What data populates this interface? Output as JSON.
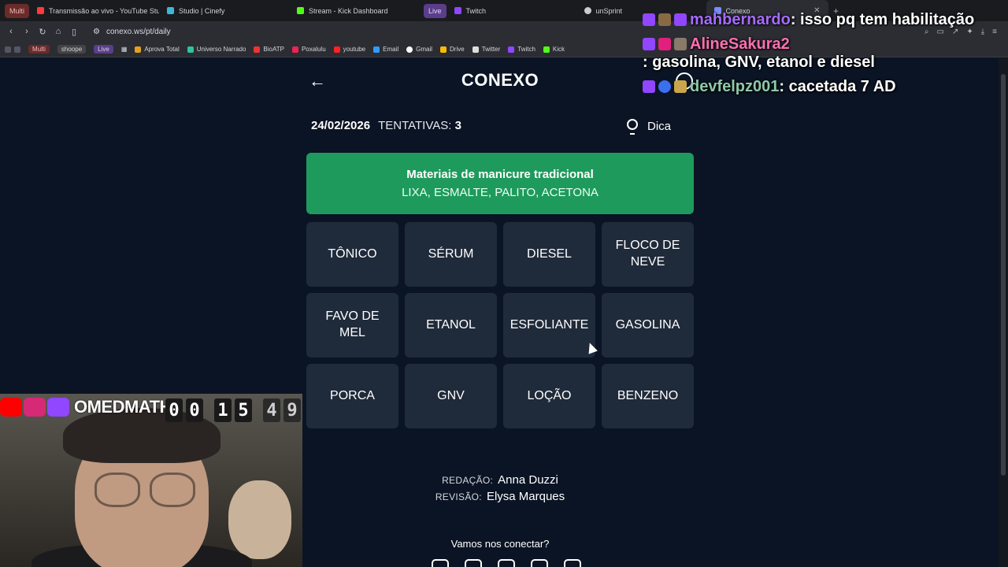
{
  "browser": {
    "tabs": [
      {
        "label": "Transmissão ao vivo - YouTube Studio",
        "color": "#ff3b3b"
      },
      {
        "label": "Studio | Cinefy",
        "color": "#3fb6d9"
      },
      {
        "label": "Stream - Kick Dashboard",
        "color": "#53fc18"
      },
      {
        "label": "Twitch",
        "color": "#9146ff"
      },
      {
        "label": "unSprint",
        "color": "#cccccc"
      },
      {
        "label": "Conexo",
        "color": "#7a8cff"
      }
    ],
    "multi_label": "Multi",
    "live_label": "Live",
    "url": "conexo.ws/pt/daily",
    "bookmarks": {
      "multi": "Multi",
      "shoope": "shoope",
      "live": "Live",
      "items": [
        "Aprova Total",
        "Universo Narrado",
        "BioATP",
        "Poxalulu",
        "youtube",
        "Email",
        "Gmail",
        "Drive",
        "Twitter",
        "Twitch",
        "Kick"
      ]
    }
  },
  "game": {
    "title": "CONEXO",
    "date": "24/02/2026",
    "tries_label": "TENTATIVAS:",
    "tries_value": "3",
    "hint_label": "Dica",
    "solved": {
      "category": "Materiais de manicure tradicional",
      "words": "LIXA, ESMALTE, PALITO, ACETONA"
    },
    "tiles": [
      "TÔNICO",
      "SÉRUM",
      "DIESEL",
      "FLOCO DE NEVE",
      "FAVO DE MEL",
      "ETANOL",
      "ESFOLIANTE",
      "GASOLINA",
      "PORCA",
      "GNV",
      "LOÇÃO",
      "BENZENO"
    ],
    "credits": {
      "editing_label": "REDAÇÃO:",
      "editing_name": "Anna Duzzi",
      "review_label": "REVISÃO:",
      "review_name": "Elysa Marques"
    },
    "connect_label": "Vamos nos conectar?"
  },
  "chat": [
    {
      "user": "mahbernardo",
      "text": ": isso pq tem habilitação"
    },
    {
      "user": "AlineSakura2",
      "text": ": gasolina, GNV, etanol e diesel"
    },
    {
      "user": "devfelpz001",
      "text": ": cacetada 7 AD"
    }
  ],
  "overlay": {
    "channel": "OMEDMATH",
    "timer": [
      "0",
      "0",
      "1",
      "5",
      "4",
      "9"
    ]
  }
}
